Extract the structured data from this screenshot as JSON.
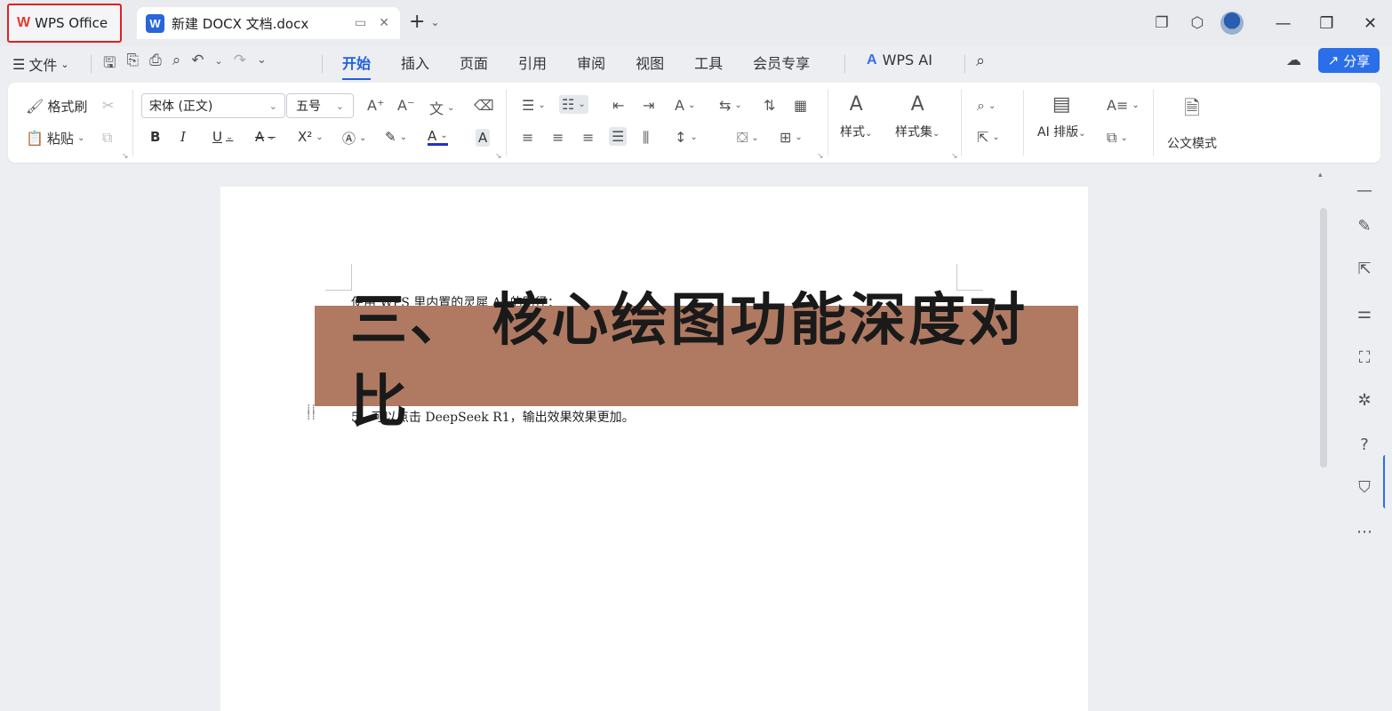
{
  "titlebar": {
    "app_name": "WPS Office",
    "doc_tab": "新建 DOCX 文档.docx",
    "new_tab": "+"
  },
  "menubar": {
    "file": "文件",
    "tabs": [
      "开始",
      "插入",
      "页面",
      "引用",
      "审阅",
      "视图",
      "工具",
      "会员专享"
    ],
    "wps_ai": "WPS AI",
    "share": "分享"
  },
  "ribbon": {
    "format_painter": "格式刷",
    "paste": "粘贴",
    "font_name": "宋体 (正文)",
    "font_size": "五号",
    "styles": "样式",
    "style_set": "样式集",
    "ai_layout": "AI 排版",
    "official_mode": "公文模式"
  },
  "document": {
    "line1": "使用 WPS 里内置的灵犀 AI 的路径：",
    "line5": "5、可以点击 DeepSeek R1，输出效果效果更加。"
  },
  "overlay": {
    "title": "三、 核心绘图功能深度对比",
    "color": "#b07a62"
  },
  "colors": {
    "accent": "#1f5fe0",
    "share_button": "#2a6ee8",
    "highlight_border": "#e02020"
  }
}
